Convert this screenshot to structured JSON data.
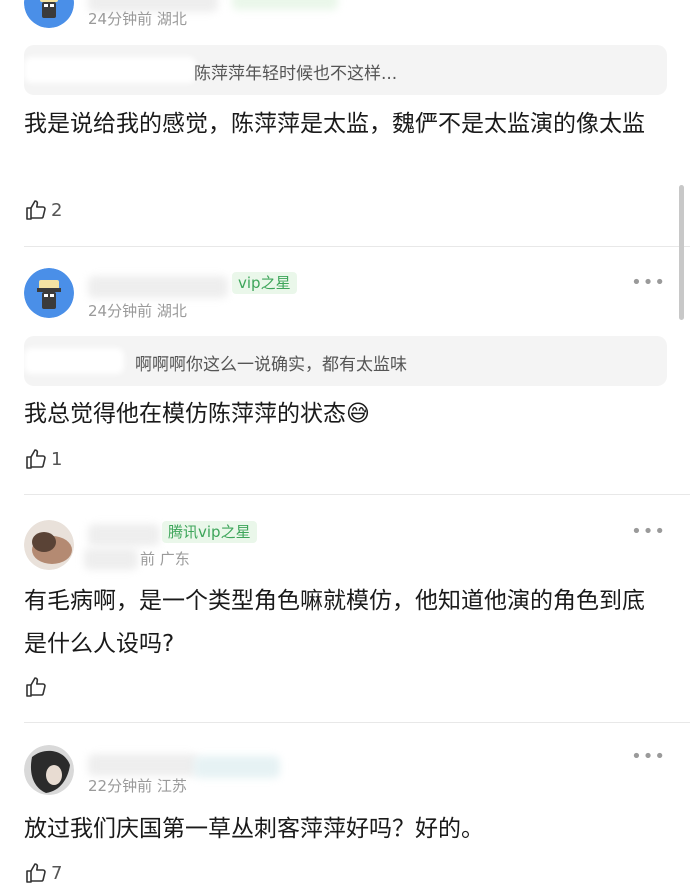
{
  "comments": [
    {
      "meta": "24分钟前 湖北",
      "quote": "陈萍萍年轻时候也不这样...",
      "body": "我是说给我的感觉，陈萍萍是太监，魏俨不是太监演的像太监",
      "likes": "2",
      "avatar_icon": "robot-avatar-icon"
    },
    {
      "badge": "vip之星",
      "meta": "24分钟前 湖北",
      "more": "•••",
      "quote": "啊啊啊你这么一说确实，都有太监味",
      "body": "我总觉得他在模仿陈萍萍的状态😅",
      "likes": "1",
      "avatar_icon": "robot-avatar-icon"
    },
    {
      "badge": "腾讯vip之星",
      "meta": "前 广东",
      "more": "•••",
      "body": "有毛病啊，是一个类型角色嘛就模仿，他知道他演的角色到底是什么人设吗?",
      "likes": "",
      "avatar_icon": "photo-avatar-icon"
    },
    {
      "meta": "22分钟前 江苏",
      "more": "•••",
      "body": "放过我们庆国第一草丛刺客萍萍好吗？好的。",
      "likes": "7",
      "avatar_icon": "dark-photo-avatar-icon"
    }
  ],
  "colors": {
    "badge_green": "#3da55a",
    "meta_gray": "#9a9a9a",
    "quote_bg": "#f4f4f4"
  }
}
